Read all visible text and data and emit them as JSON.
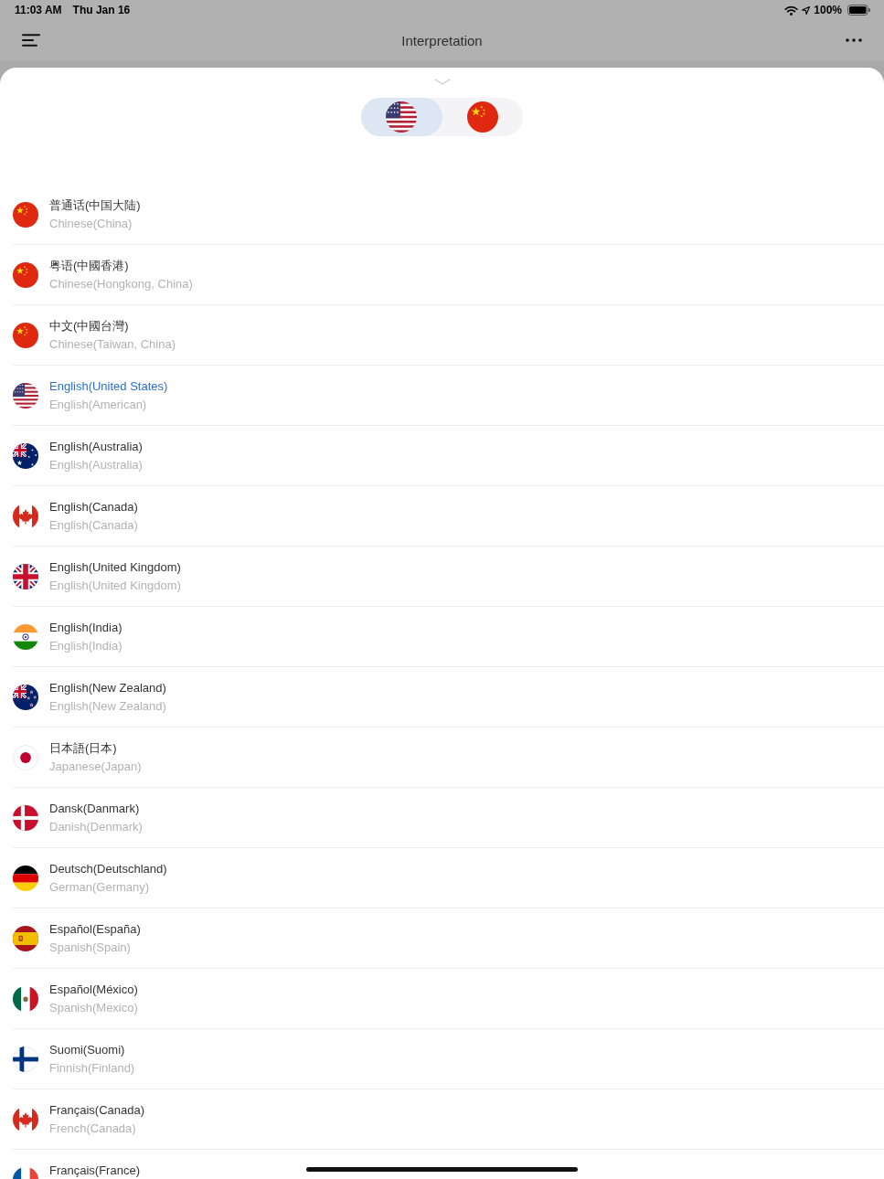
{
  "status_bar": {
    "time": "11:03 AM",
    "date": "Thu Jan 16",
    "battery": "100%"
  },
  "nav_bar": {
    "title": "Interpretation"
  },
  "language_toggle": [
    {
      "kind": "usa",
      "selected": true
    },
    {
      "kind": "china",
      "selected": false
    }
  ],
  "languages": [
    {
      "kind": "china",
      "name": "普通话(中国大陆)",
      "subtitle": "Chinese(China)",
      "selected": false
    },
    {
      "kind": "china",
      "name": "粤语(中國香港)",
      "subtitle": "Chinese(Hongkong, China)",
      "selected": false
    },
    {
      "kind": "china",
      "name": "中文(中國台灣)",
      "subtitle": "Chinese(Taiwan, China)",
      "selected": false
    },
    {
      "kind": "usa",
      "name": "English(United States)",
      "subtitle": "English(American)",
      "selected": true
    },
    {
      "kind": "australia",
      "name": "English(Australia)",
      "subtitle": "English(Australia)",
      "selected": false
    },
    {
      "kind": "canada",
      "name": "English(Canada)",
      "subtitle": "English(Canada)",
      "selected": false
    },
    {
      "kind": "uk",
      "name": "English(United Kingdom)",
      "subtitle": "English(United Kingdom)",
      "selected": false
    },
    {
      "kind": "india",
      "name": "English(India)",
      "subtitle": "English(India)",
      "selected": false
    },
    {
      "kind": "newzealand",
      "name": "English(New Zealand)",
      "subtitle": "English(New Zealand)",
      "selected": false
    },
    {
      "kind": "japan",
      "name": "日本語(日本)",
      "subtitle": "Japanese(Japan)",
      "selected": false
    },
    {
      "kind": "denmark",
      "name": "Dansk(Danmark)",
      "subtitle": "Danish(Denmark)",
      "selected": false
    },
    {
      "kind": "germany",
      "name": "Deutsch(Deutschland)",
      "subtitle": "German(Germany)",
      "selected": false
    },
    {
      "kind": "spain",
      "name": "Español(España)",
      "subtitle": "Spanish(Spain)",
      "selected": false
    },
    {
      "kind": "mexico",
      "name": "Español(México)",
      "subtitle": "Spanish(Mexico)",
      "selected": false
    },
    {
      "kind": "finland",
      "name": "Suomi(Suomi)",
      "subtitle": "Finnish(Finland)",
      "selected": false
    },
    {
      "kind": "canada",
      "name": "Français(Canada)",
      "subtitle": "French(Canada)",
      "selected": false
    },
    {
      "kind": "france",
      "name": "Français(France)",
      "selected": false
    }
  ]
}
